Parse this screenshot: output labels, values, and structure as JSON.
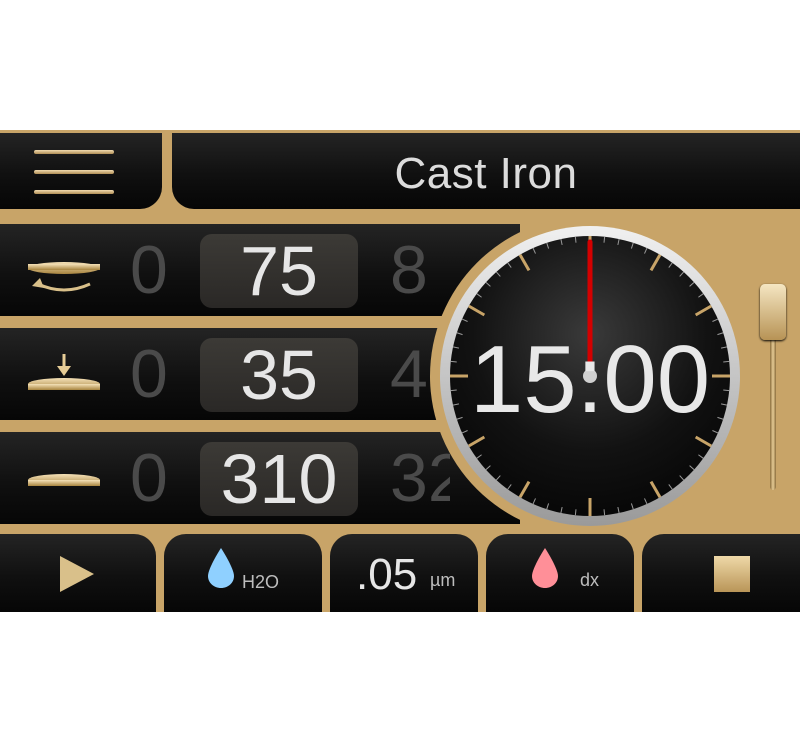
{
  "header": {
    "title": "Cast Iron"
  },
  "rows": [
    {
      "value": "75",
      "ghost_left": "0",
      "ghost_right": "8"
    },
    {
      "value": "35",
      "ghost_left": "0",
      "ghost_right": "4"
    },
    {
      "value": "310",
      "ghost_left": "0",
      "ghost_right": "32"
    }
  ],
  "timer": {
    "display": "15:00"
  },
  "slider": {
    "level": 1.0
  },
  "bottom": {
    "water_label": "H2O",
    "value": ".05",
    "unit": "µm",
    "dx_label": "dx"
  },
  "colors": {
    "gold": "#c8a468",
    "needle": "#d40000",
    "water_drop": "#8fd0ff",
    "pink_drop": "#ff8f98",
    "bar_bg": "#101010"
  },
  "icons": {
    "menu": "hamburger-icon",
    "row1": "rotation-icon",
    "row2": "pressure-icon",
    "row3": "disc-icon",
    "play": "play-icon",
    "water": "water-drop-icon",
    "dx": "pink-drop-icon",
    "stop": "stop-icon"
  }
}
